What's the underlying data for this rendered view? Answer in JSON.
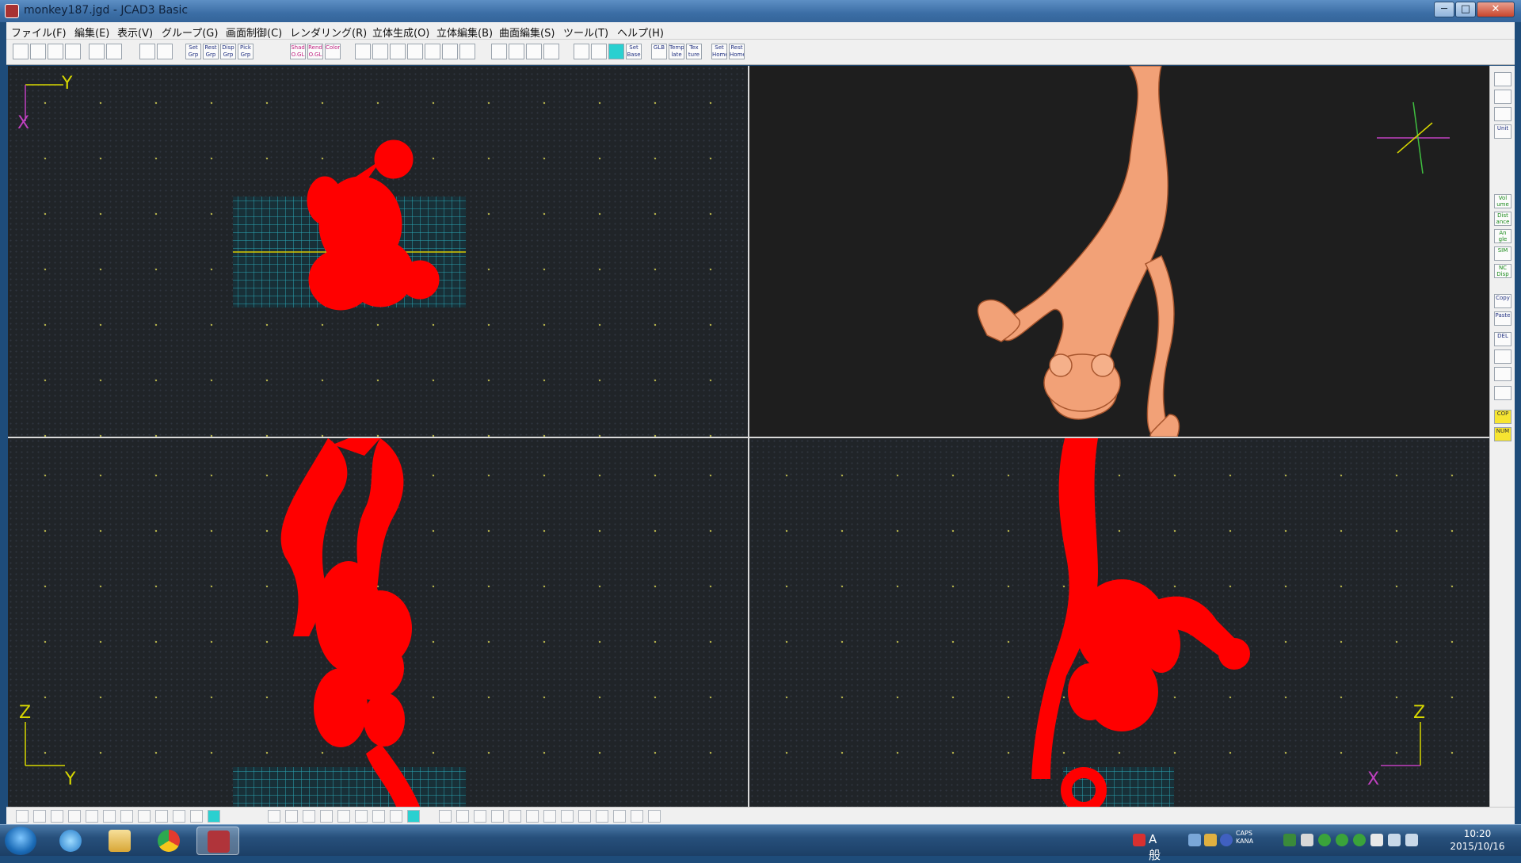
{
  "window": {
    "title": "monkey187.jgd - JCAD3 Basic",
    "controls": {
      "minimize": "─",
      "maximize": "□",
      "close": "✕"
    }
  },
  "menu": [
    "ファイル(F)",
    "編集(E)",
    "表示(V)",
    "グループ(G)",
    "画面制御(C)",
    "レンダリング(R)",
    "立体生成(O)",
    "立体編集(B)",
    "曲面編集(S)",
    "ツール(T)",
    "ヘルプ(H)"
  ],
  "toolbar": {
    "set_grp": "Set Grp",
    "rest_grp": "Rest Grp",
    "disp_grp": "Disp Grp",
    "pick_grp": "Pick Grp",
    "shad_ogl": "Shad O.GL",
    "rend_ogl": "Rend O.GL",
    "color": "Color",
    "set_base": "Set Base",
    "glb": "GLB",
    "template": "Temp late",
    "texture": "Tex ture",
    "set_home": "Set Home",
    "rest_home": "Rest Home"
  },
  "viewports": {
    "top_left": {
      "axis_h": "Y",
      "axis_v": "X",
      "axis_colors": {
        "h": "#d8d800",
        "v": "#c040c0"
      }
    },
    "bottom_left": {
      "axis_v": "Z",
      "axis_h": "Y",
      "axis_colors": {
        "h": "#d8d800",
        "v": "#d8d800"
      }
    },
    "bottom_right": {
      "axis_v": "Z",
      "axis_h": "X",
      "axis_colors": {
        "h": "#c040c0",
        "v": "#d8d800"
      }
    },
    "model_color_wire": "#ff0000",
    "model_color_shaded": "#f2a177",
    "grid_color": "#2aa6b4"
  },
  "side_panel": {
    "unit": "Unit",
    "volume": "Vol ume",
    "distance": "Dist ance",
    "angle": "An gle",
    "sim": "SIM",
    "nc_disp": "NC Disp",
    "copy": "Copy",
    "paste": "Paste",
    "del": "DEL",
    "cop": "COP",
    "num": "NUM"
  },
  "taskbar": {
    "ime": "A 般",
    "caps": "CAPS",
    "kana": "KANA",
    "time": "10:20",
    "date": "2015/10/16"
  }
}
